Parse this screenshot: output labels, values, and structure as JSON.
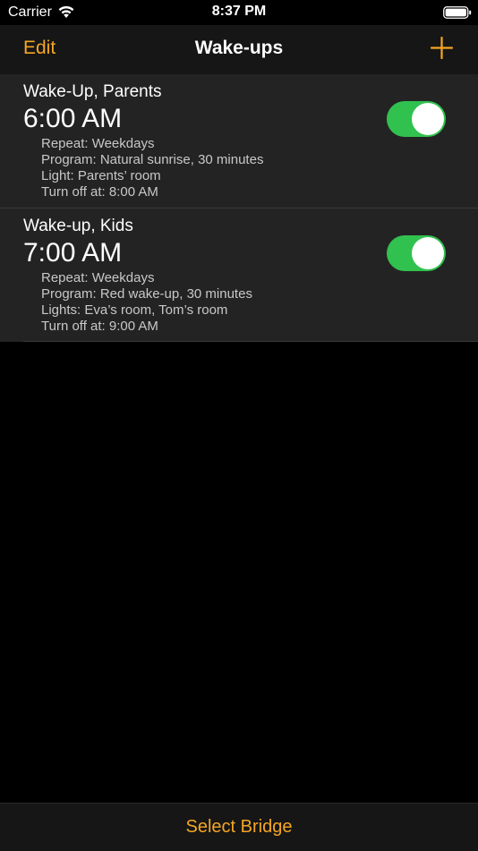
{
  "status_bar": {
    "carrier": "Carrier",
    "time": "8:37 PM",
    "wifi_icon": "wifi-icon",
    "battery_icon": "battery-icon"
  },
  "nav": {
    "edit_label": "Edit",
    "title": "Wake-ups",
    "add_icon": "plus-icon"
  },
  "wakeups": [
    {
      "title": "Wake-Up, Parents",
      "time": "6:00 AM",
      "details": [
        "Repeat: Weekdays",
        "Program: Natural sunrise, 30 minutes",
        "Light: Parents’ room",
        "Turn off at: 8:00 AM"
      ],
      "enabled": true
    },
    {
      "title": "Wake-up, Kids",
      "time": "7:00 AM",
      "details": [
        "Repeat: Weekdays",
        "Program: Red wake-up, 30 minutes",
        "Lights: Eva’s room, Tom’s room",
        "Turn off at: 9:00 AM"
      ],
      "enabled": true
    }
  ],
  "footer": {
    "select_bridge_label": "Select Bridge"
  },
  "colors": {
    "accent": "#f5a623",
    "toggle_on": "#31c14f",
    "background": "#000000",
    "row_background": "#232323",
    "bar_background": "#161616"
  }
}
